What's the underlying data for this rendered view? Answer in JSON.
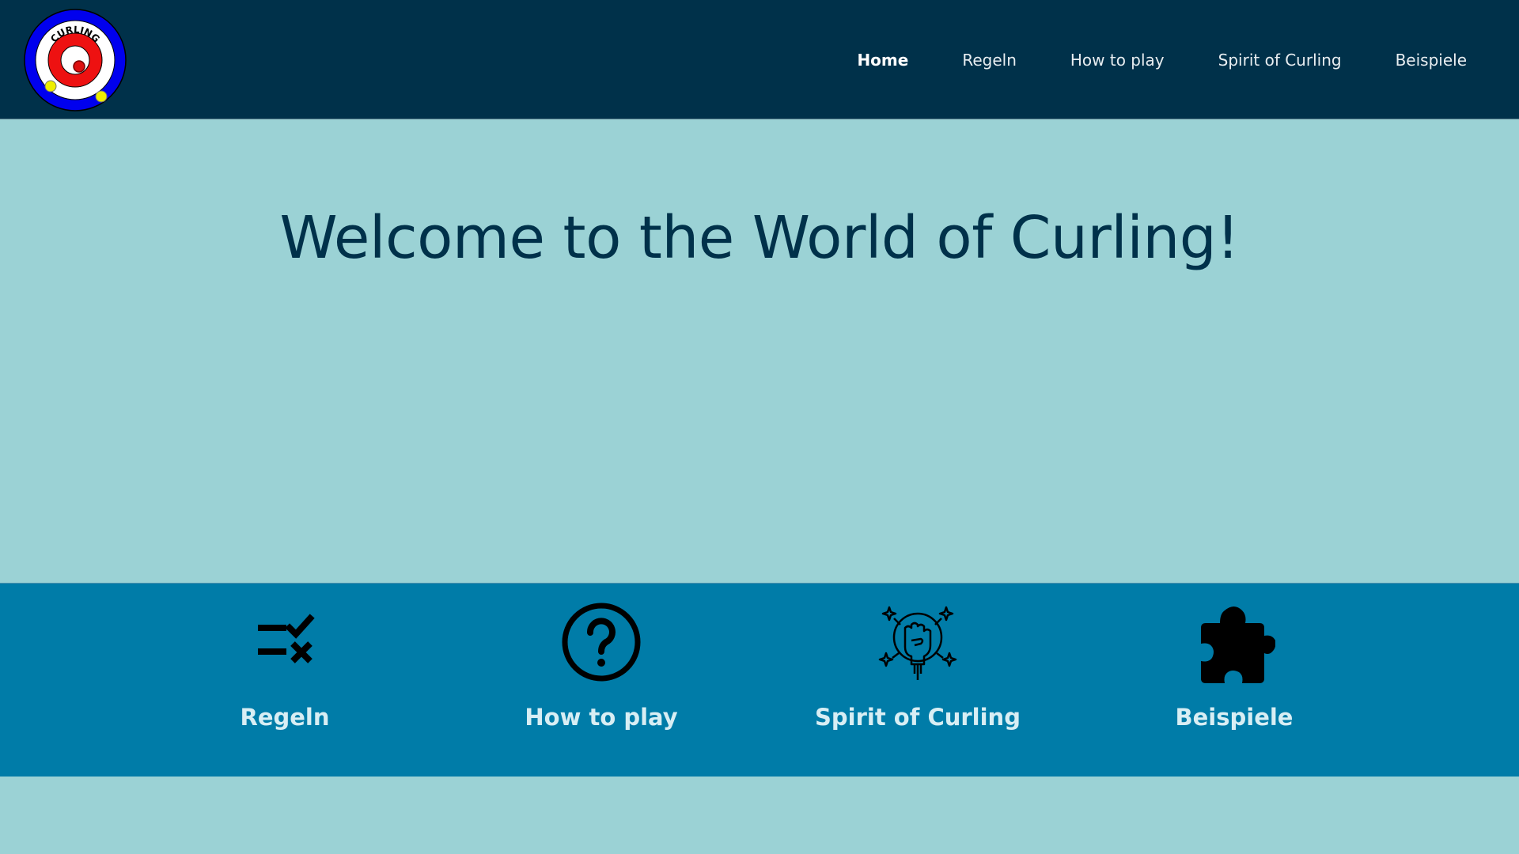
{
  "header": {
    "logo_text": "CURLING",
    "nav": [
      {
        "label": "Home",
        "active": true
      },
      {
        "label": "Regeln",
        "active": false
      },
      {
        "label": "How to play",
        "active": false
      },
      {
        "label": "Spirit of Curling",
        "active": false
      },
      {
        "label": "Beispiele",
        "active": false
      }
    ]
  },
  "hero": {
    "title": "Welcome to the World of Curling!"
  },
  "features": [
    {
      "label": "Regeln",
      "icon": "rules-check-cross-icon"
    },
    {
      "label": "How to play",
      "icon": "question-circle-icon"
    },
    {
      "label": "Spirit of Curling",
      "icon": "raised-fist-icon"
    },
    {
      "label": "Beispiele",
      "icon": "puzzle-piece-icon"
    }
  ],
  "colors": {
    "header_bg": "#00314a",
    "page_bg": "#9bd2d5",
    "features_bg": "#007ca8",
    "title": "#00314a",
    "feature_label": "#d8eef4"
  }
}
